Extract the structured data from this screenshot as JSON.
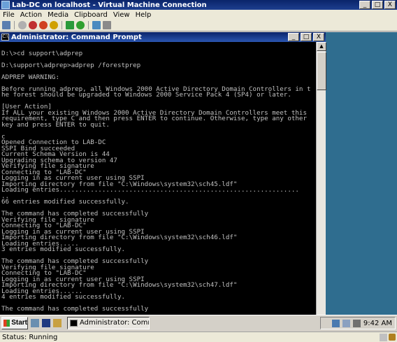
{
  "vm_window": {
    "title": "Lab-DC on localhost - Virtual Machine Connection",
    "controls": {
      "minimize": "_",
      "maximize": "□",
      "close": "X"
    }
  },
  "menu": [
    "File",
    "Action",
    "Media",
    "Clipboard",
    "View",
    "Help"
  ],
  "toolbar": {
    "icons": [
      "ctrl-alt-del-icon",
      "start-icon",
      "turn-off-icon",
      "shutdown-icon",
      "reset-icon",
      "pause-icon",
      "resume-icon",
      "snapshot-icon",
      "revert-icon"
    ]
  },
  "cmd_window": {
    "title": "Administrator: Command Prompt",
    "icon_text": "C:\\",
    "controls": {
      "minimize": "_",
      "maximize": "□",
      "close": "X"
    },
    "console_lines": [
      "",
      "D:\\>cd support\\adprep",
      "",
      "D:\\support\\adprep>adprep /forestprep",
      "",
      "ADPREP WARNING:",
      "",
      "Before running adprep, all Windows 2000 Active Directory Domain Controllers in t",
      "he forest should be upgraded to Windows 2000 Service Pack 4 (SP4) or later.",
      "",
      "[User Action]",
      "If ALL your existing Windows 2000 Active Directory Domain Controllers meet this",
      "requirement, type C and then press ENTER to continue. Otherwise, type any other",
      "key and press ENTER to quit.",
      "",
      "c",
      "Opened Connection to LAB-DC",
      "SSPI Bind succeeded",
      "Current Schema Version is 44",
      "Upgrading schema to version 47",
      "Verifying file signature",
      "Connecting to \"LAB-DC\"",
      "Logging in as current user using SSPI",
      "Importing directory from file \"C:\\Windows\\system32\\sch45.ldf\"",
      "Loading entries..............................................................",
      "..",
      "66 entries modified successfully.",
      "",
      "The command has completed successfully",
      "Verifying file signature",
      "Connecting to \"LAB-DC\"",
      "Logging in as current user using SSPI",
      "Importing directory from file \"C:\\Windows\\system32\\sch46.ldf\"",
      "Loading entries.....",
      "3 entries modified successfully.",
      "",
      "The command has completed successfully",
      "Verifying file signature",
      "Connecting to \"LAB-DC\"",
      "Logging in as current user using SSPI",
      "Importing directory from file \"C:\\Windows\\system32\\sch47.ldf\"",
      "Loading entries......",
      "4 entries modified successfully.",
      "",
      "The command has completed successfully"
    ]
  },
  "taskbar": {
    "start_label": "Start",
    "task_label": "Administrator: Comm...",
    "clock": "9:42 AM"
  },
  "status": {
    "text": "Status: Running"
  }
}
